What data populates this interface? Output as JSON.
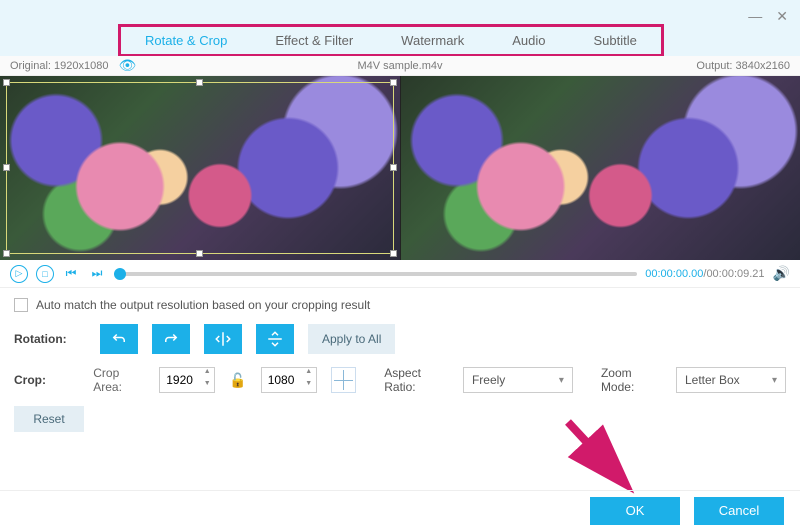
{
  "window": {
    "minimize": "—",
    "close": "✕"
  },
  "tabs": {
    "rotate_crop": "Rotate & Crop",
    "effect_filter": "Effect & Filter",
    "watermark": "Watermark",
    "audio": "Audio",
    "subtitle": "Subtitle"
  },
  "info": {
    "original_label": "Original:",
    "original_res": "1920x1080",
    "filename": "M4V sample.m4v",
    "output_label": "Output:",
    "output_res": "3840x2160"
  },
  "playback": {
    "current": "00:00:00.00",
    "sep": "/",
    "duration": "00:00:09.21"
  },
  "auto_match": {
    "label": "Auto match the output resolution based on your cropping result",
    "checked": false
  },
  "rotation": {
    "label": "Rotation:",
    "apply_all": "Apply to All"
  },
  "crop": {
    "label": "Crop:",
    "area_label": "Crop Area:",
    "width": "1920",
    "height": "1080",
    "aspect_label": "Aspect Ratio:",
    "aspect_value": "Freely",
    "zoom_label": "Zoom Mode:",
    "zoom_value": "Letter Box",
    "reset": "Reset"
  },
  "footer": {
    "ok": "OK",
    "cancel": "Cancel"
  },
  "colors": {
    "accent": "#1cb0e8",
    "highlight": "#d11a6a"
  }
}
